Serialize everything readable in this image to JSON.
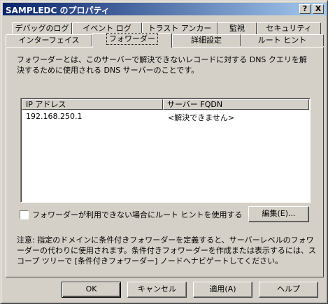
{
  "window": {
    "title": "SAMPLEDC のプロパティ",
    "help_button": "?",
    "close_button": "X"
  },
  "tabs": {
    "row1": [
      {
        "label": "デバッグのログ"
      },
      {
        "label": "イベント ログ"
      },
      {
        "label": "トラスト アンカー"
      },
      {
        "label": "監視"
      },
      {
        "label": "セキュリティ"
      }
    ],
    "row2": [
      {
        "label": "インターフェイス"
      },
      {
        "label": "フォワーダー"
      },
      {
        "label": "詳細設定"
      },
      {
        "label": "ルート ヒント"
      }
    ],
    "active": "フォワーダー"
  },
  "panel": {
    "description": "フォワーダーとは、このサーバーで解決できないレコードに対する DNS クエリを解決するために使用される DNS サーバーのことです。",
    "list": {
      "columns": [
        "IP アドレス",
        "サーバー FQDN"
      ],
      "rows": [
        {
          "ip": "192.168.250.1",
          "fqdn": "<解決できません>"
        }
      ]
    },
    "checkbox": {
      "label": "フォワーダーが利用できない場合にルート ヒントを使用する",
      "checked": false
    },
    "edit_button": "編集(E)...",
    "note": "注意: 指定のドメインに条件付きフォワーダーを定義すると、サーバーレベルのフォワーダーの代わりに使用されます。条件付きフォワーダーを作成または表示するには、スコープ ツリーで [条件付きフォワーダー] ノードへナビゲートしてください。"
  },
  "buttons": {
    "ok": "OK",
    "cancel": "キャンセル",
    "apply": "適用(A)",
    "help": "ヘルプ"
  }
}
